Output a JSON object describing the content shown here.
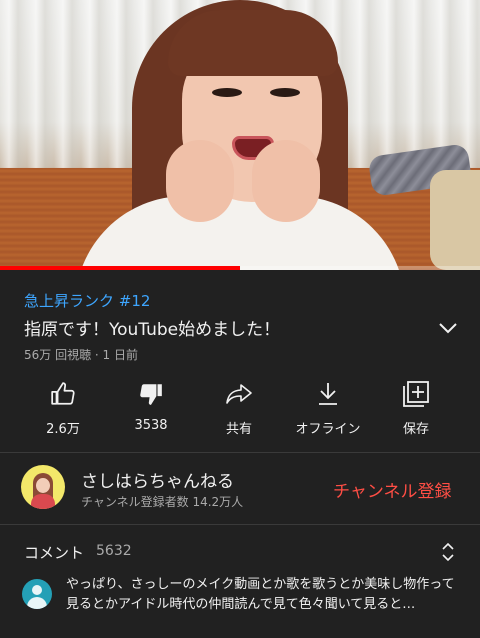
{
  "video": {
    "progress": 0.5
  },
  "info": {
    "hashtag": "急上昇ランク #12",
    "title": "指原です！YouTube始めました！",
    "meta": "56万 回視聴 · 1 日前"
  },
  "actions": [
    {
      "label": "2.6万",
      "icon": "thumb-up-icon"
    },
    {
      "label": "3538",
      "icon": "thumb-down-icon"
    },
    {
      "label": "共有",
      "icon": "share-icon"
    },
    {
      "label": "オフライン",
      "icon": "download-icon"
    },
    {
      "label": "保存",
      "icon": "add-to-playlist-icon"
    }
  ],
  "channel": {
    "name": "さしはらちゃんねる",
    "subscribers": "チャンネル登録者数 14.2万人",
    "subscribe_label": "チャンネル登録"
  },
  "comments": {
    "label": "コメント",
    "count": "5632",
    "top_comment": "やっぱり、さっしーのメイク動画とか歌を歌うとか美味し物作って見るとかアイドル時代の仲間読んで見て色々聞いて見ると…"
  },
  "colors": {
    "background": "#212121",
    "hashtag": "#3ea6ff",
    "subscribe": "#ff4e45",
    "progress": "#ff0000"
  }
}
